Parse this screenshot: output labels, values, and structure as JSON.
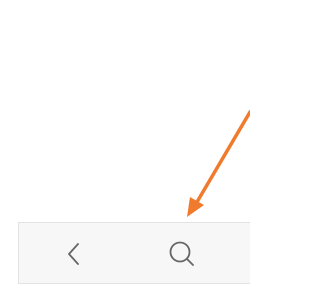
{
  "bottom_toolbar": {
    "buttons": [
      {
        "icon": "chevron-left-icon",
        "action": "back"
      },
      {
        "icon": "search-icon",
        "action": "search"
      }
    ]
  },
  "annotation": {
    "type": "arrow",
    "color": "#f07a2e",
    "target": "search-button"
  },
  "colors": {
    "page_background": "#ffffff",
    "toolbar_background": "#f7f7f7",
    "toolbar_border": "#e3e3e3",
    "icon_stroke": "#666666"
  }
}
